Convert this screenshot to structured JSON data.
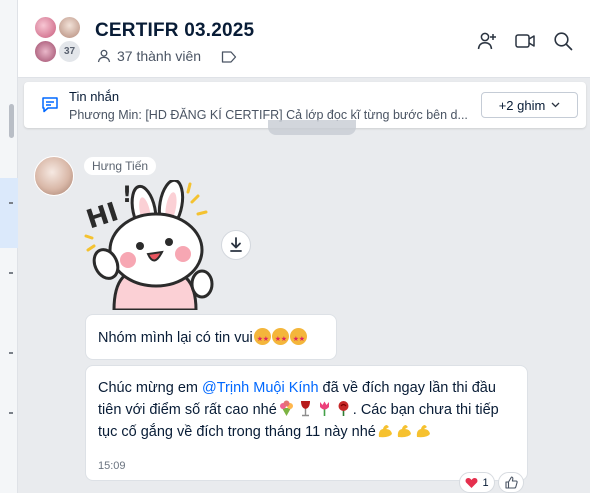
{
  "header": {
    "group_name": "CERTIFR 03.2025",
    "avatar_count": "37",
    "member_count": "37 thành viên",
    "icons": [
      "add-member-icon",
      "video-call-icon",
      "search-icon"
    ]
  },
  "pinned": {
    "title": "Tin nhắn",
    "preview": "Phương Min: [HD ĐĂNG KÍ CERTIFR] Cả lớp đọc kĩ từng bước bên d...",
    "more_label": "+2 ghim"
  },
  "messages": {
    "sender_name": "Hưng Tiến",
    "sticker": "hi-bunny-sticker",
    "msg1": "Nhóm mình lại có tin vui",
    "msg2_before": "Chúc mừng em ",
    "msg2_mention": "@Trịnh Muội Kính",
    "msg2_mid": " đã về đích ngay lần thi đầu tiên với điểm số rất cao nhé",
    "msg2_mid2": ". Các bạn chưa thi tiếp tục cố gắng về đích trong tháng 11 này nhé",
    "time": "15:09",
    "reaction_count": "1",
    "colors": {
      "mention": "#0068ff",
      "heart": "#e5304e",
      "strong": "#f6c12f"
    }
  }
}
